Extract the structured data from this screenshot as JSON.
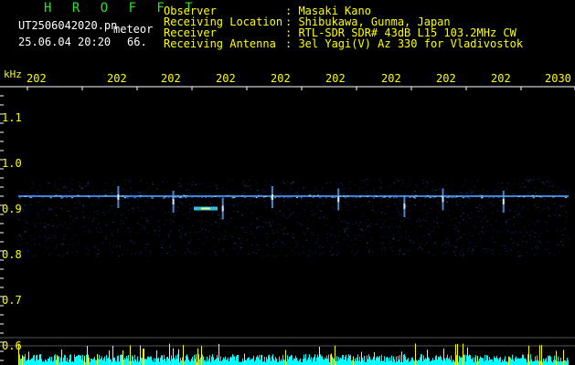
{
  "header": {
    "brand": "H R O F F T",
    "filename": "UT2506042020.pn",
    "filetype": "meteor",
    "datetime": "25.06.04 20:20",
    "count": "66.",
    "info": [
      {
        "label": "Observer",
        "value": ": Masaki Kano"
      },
      {
        "label": "Receiving Location",
        "value": ": Shibukawa, Gunma, Japan"
      },
      {
        "label": "Receiver",
        "value": ": RTL-SDR SDR# 43dB L15 103.2MHz CW"
      },
      {
        "label": "Receiving Antenna",
        "value": ": 3el Yagi(V) Az 330 for Vladivostok"
      }
    ]
  },
  "axis": {
    "unit": "kHz",
    "y_ticks": [
      "1.1",
      "1.0",
      "0.9",
      "0.8",
      "0.7",
      "0.6"
    ],
    "x_ticks": [
      "202",
      "202",
      "202",
      "202",
      "202",
      "202",
      "202",
      "202",
      "202",
      "2030"
    ]
  },
  "colors": {
    "background": "#000000",
    "label": "#ffff00",
    "brand": "#2ee02e",
    "text": "#ffffff",
    "signal": "#3399ff",
    "noise_bar": "#00ffff"
  },
  "chart_data": {
    "type": "heatmap",
    "ylabel": "kHz",
    "ylim": [
      0.58,
      1.15
    ],
    "signal_band_khz": [
      0.8,
      0.97
    ],
    "carrier_khz": 0.932,
    "meteor_streaks": [
      {
        "x": 0.18,
        "f": 0.93
      },
      {
        "x": 0.28,
        "f": 0.92
      },
      {
        "x": 0.37,
        "f": 0.905
      },
      {
        "x": 0.46,
        "f": 0.93
      },
      {
        "x": 0.58,
        "f": 0.925
      },
      {
        "x": 0.7,
        "f": 0.91
      },
      {
        "x": 0.77,
        "f": 0.925
      },
      {
        "x": 0.88,
        "f": 0.92
      }
    ]
  }
}
